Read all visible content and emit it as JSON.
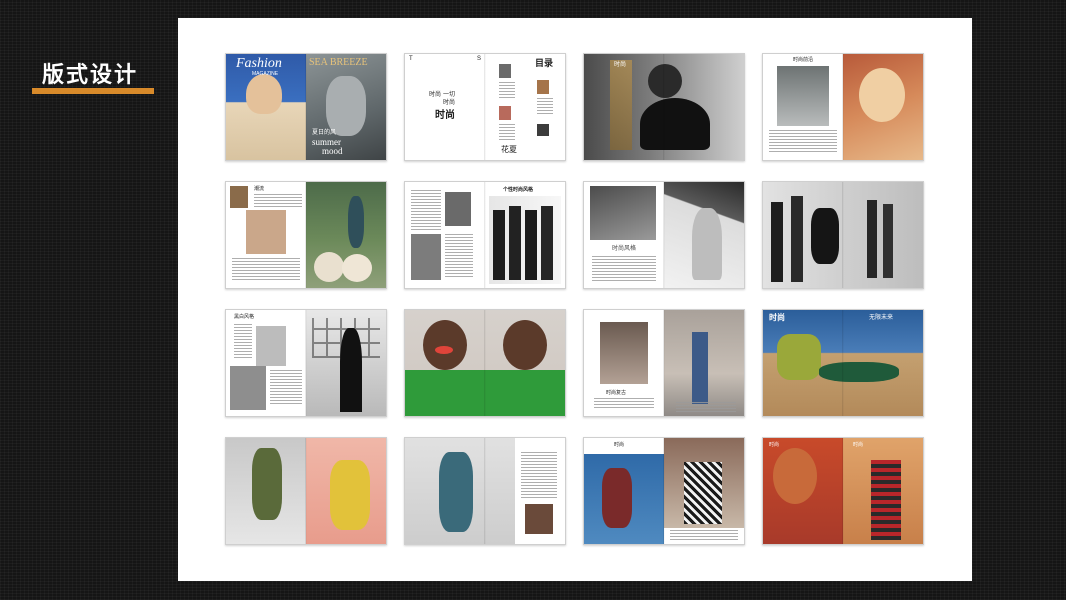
{
  "slide": {
    "title": "版式设计",
    "accent_color": "#d88a2a",
    "background_color": "#151515",
    "board_color": "#ffffff"
  },
  "spreads": [
    {
      "row": 1,
      "col": 1,
      "texts": {
        "masthead": "Fashion",
        "sub": "MAGAZINE",
        "right_title": "SEA BREEZE",
        "cn": "夏日的风",
        "mood_1": "summer",
        "mood_2": "mood"
      }
    },
    {
      "row": 1,
      "col": 2,
      "texts": {
        "toc": "目录",
        "left_1": "时尚",
        "left_2": "一切",
        "left_3": "时尚",
        "big": "时尚",
        "right_bottom": "花夏",
        "letter_t": "T",
        "letter_s": "S"
      }
    },
    {
      "row": 1,
      "col": 3,
      "texts": {
        "side": "时尚"
      }
    },
    {
      "row": 1,
      "col": 4,
      "texts": {
        "head": "时尚前沿"
      }
    },
    {
      "row": 2,
      "col": 1,
      "texts": {
        "head": "潮流"
      }
    },
    {
      "row": 2,
      "col": 2,
      "texts": {
        "head": "个性时尚风格"
      }
    },
    {
      "row": 2,
      "col": 3,
      "texts": {
        "head": "时尚风格"
      }
    },
    {
      "row": 2,
      "col": 4,
      "texts": {}
    },
    {
      "row": 3,
      "col": 1,
      "texts": {
        "head": "黑白风格"
      }
    },
    {
      "row": 3,
      "col": 2,
      "texts": {}
    },
    {
      "row": 3,
      "col": 3,
      "texts": {
        "head": "时尚复古"
      }
    },
    {
      "row": 3,
      "col": 4,
      "texts": {
        "left": "时尚",
        "right": "无限未来"
      }
    },
    {
      "row": 4,
      "col": 1,
      "texts": {}
    },
    {
      "row": 4,
      "col": 2,
      "texts": {}
    },
    {
      "row": 4,
      "col": 3,
      "texts": {
        "head": "时尚"
      }
    },
    {
      "row": 4,
      "col": 4,
      "texts": {
        "a": "时尚",
        "b": "时尚"
      }
    }
  ]
}
